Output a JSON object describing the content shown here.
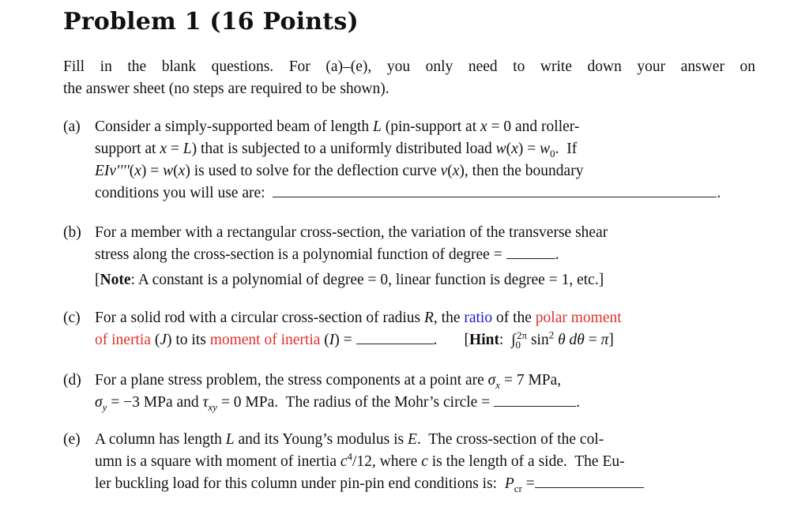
{
  "title": "Problem 1 (16 Points)",
  "intro": {
    "line1": "Fill in the blank questions.  For (a)–(e), you only need to write down your answer on",
    "line2": "the answer sheet (no steps are required to be shown)."
  },
  "questions": [
    {
      "label": "(a)",
      "lines": [
        "Consider a simply-supported beam of length L (pin-support at x = 0 and roller-",
        "support at x = L) that is subjected to a uniformly distributed load w(x) = w₀.  If",
        "EIv''''(x) = w(x) is used to solve for the deflection curve v(x), then the boundary",
        "conditions you will use are:"
      ],
      "answer": ""
    },
    {
      "label": "(b)",
      "lines": [
        "For a member with a rectangular cross-section, the variation of the transverse shear",
        "stress along the cross-section is a polynomial function of degree ="
      ],
      "note_label": "Note",
      "note_text": ": A constant is a polynomial of degree = 0, linear function is degree = 1, etc.",
      "answer": ""
    },
    {
      "label": "(c)",
      "line1_a": "For a solid rod with a circular cross-section of radius ",
      "line1_R": "R",
      "line1_b": ", the ",
      "ratio_word": "ratio",
      "line1_c": " of the ",
      "polar_1": "polar moment",
      "polar_2": "of inertia",
      "J": "(J)",
      "to_its": " to its ",
      "moi": "moment of inertia",
      "I": "(I) =",
      "hint_label": "Hint",
      "hint_expr": "∫₀²π sin² θ dθ = π",
      "answer": ""
    },
    {
      "label": "(d)",
      "line1": "For a plane stress problem, the stress components at a point are σx = 7 MPa,",
      "line2": "σy = −3 MPa and τxy = 0 MPa.  The radius of the Mohr’s circle =",
      "answer": ""
    },
    {
      "label": "(e)",
      "lines": [
        "A column has length L and its Young’s modulus is E.  The cross-section of the col-",
        "umn is a square with moment of inertia c⁴/12, where c is the length of a side.  The Eu-",
        "ler buckling load for this column under pin-pin end conditions is:  P_cr ="
      ],
      "answer": ""
    }
  ],
  "colors": {
    "red": "#e0302a",
    "blue": "#1a1ad6"
  }
}
